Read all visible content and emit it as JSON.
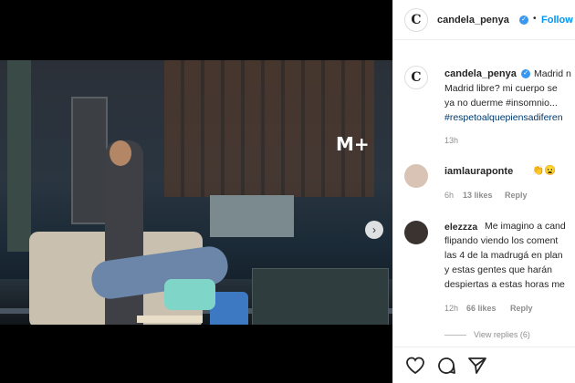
{
  "post": {
    "username": "candela_penya",
    "follow_label": "Follow",
    "separator": "•",
    "video_logo": "M+",
    "avatar_glyph": "C"
  },
  "caption": {
    "username": "candela_penya",
    "lines": [
      "Madrid n",
      "Madrid libre? mi cuerpo se",
      "ya no duerme #insomnio...",
      "#respetoalquepiensadiferen"
    ],
    "time": "13h"
  },
  "comments": [
    {
      "username": "iamlauraponte",
      "text": "👏😦",
      "time": "6h",
      "likes": "13 likes",
      "reply": "Reply",
      "avatar_color": "#d8c3b5"
    },
    {
      "username": "elezzza",
      "lines": [
        "Me imagino a cand",
        "flipando viendo los coment",
        "las 4 de la madrugá en plan",
        "y estas gentes que harán",
        "despiertas a estas horas me"
      ],
      "time": "12h",
      "likes": "66 likes",
      "reply": "Reply",
      "avatar_color": "#3a3330"
    }
  ],
  "view_replies": "View replies (6)",
  "actions": [
    "heart-icon",
    "comment-icon",
    "share-icon"
  ],
  "colors": {
    "link": "#00376b",
    "follow": "#0095f6",
    "verified": "#3897f0",
    "meta": "#8e8e8e"
  }
}
